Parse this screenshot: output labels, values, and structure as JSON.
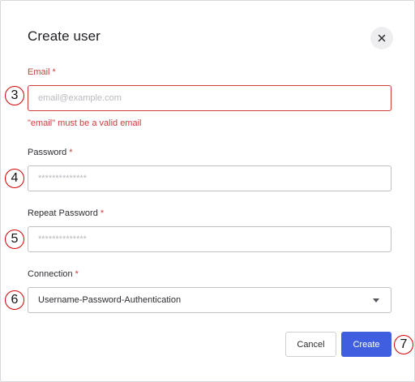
{
  "dialog": {
    "title": "Create user",
    "close_icon": "close-icon"
  },
  "fields": {
    "email": {
      "label": "Email",
      "required_mark": "*",
      "value": "",
      "placeholder": "email@example.com",
      "error": "\"email\" must be a valid email"
    },
    "password": {
      "label": "Password",
      "required_mark": "*",
      "value": "",
      "placeholder": "**************"
    },
    "repeat_password": {
      "label": "Repeat Password",
      "required_mark": "*",
      "value": "",
      "placeholder": "**************"
    },
    "connection": {
      "label": "Connection",
      "required_mark": "*",
      "selected": "Username-Password-Authentication",
      "caret_icon": "caret-down-icon"
    }
  },
  "footer": {
    "cancel_label": "Cancel",
    "create_label": "Create"
  },
  "annotations": {
    "email": "3",
    "password": "4",
    "repeat_password": "5",
    "connection": "6",
    "create": "7"
  },
  "colors": {
    "primary": "#3f5fe0",
    "error": "#d03b3b",
    "marker": "#d60000"
  }
}
